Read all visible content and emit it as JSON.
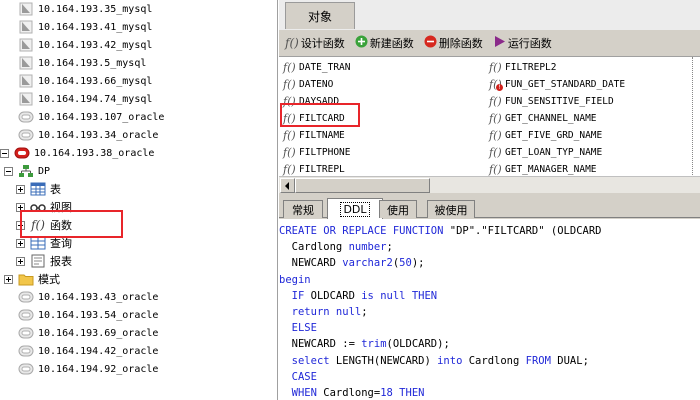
{
  "tree": {
    "items_before": [
      {
        "label": "10.164.193.35_mysql",
        "type": "mysql"
      },
      {
        "label": "10.164.193.41_mysql",
        "type": "mysql"
      },
      {
        "label": "10.164.193.42_mysql",
        "type": "mysql"
      },
      {
        "label": "10.164.193.5_mysql",
        "type": "mysql"
      },
      {
        "label": "10.164.193.66_mysql",
        "type": "mysql"
      },
      {
        "label": "10.164.194.74_mysql",
        "type": "mysql"
      },
      {
        "label": "10.164.193.107_oracle",
        "type": "oracle"
      },
      {
        "label": "10.164.193.34_oracle",
        "type": "oracle"
      }
    ],
    "expanded_server": "10.164.193.38_oracle",
    "schema": "DP",
    "schema_children": [
      "表",
      "视图",
      "函数",
      "查询",
      "报表"
    ],
    "models": "模式",
    "items_after": [
      "10.164.193.43_oracle",
      "10.164.193.54_oracle",
      "10.164.193.69_oracle",
      "10.164.194.42_oracle",
      "10.164.194.92_oracle"
    ]
  },
  "panel": {
    "tab": "对象",
    "toolbar": {
      "design": "设计函数",
      "new": "新建函数",
      "delete": "删除函数",
      "run": "运行函数"
    },
    "functions_col1": [
      "DATE_TRAN",
      "DATENO",
      "DAYSADD",
      "FILTCARD",
      "FILTNAME",
      "FILTPHONE",
      "FILTREPL"
    ],
    "functions_col2": [
      "FILTREPL2",
      "FUN_GET_STANDARD_DATE",
      "FUN_SENSITIVE_FIELD",
      "GET_CHANNEL_NAME",
      "GET_FIVE_GRD_NAME",
      "GET_LOAN_TYP_NAME",
      "GET_MANAGER_NAME"
    ],
    "subtabs": [
      "常规",
      "DDL",
      "使用",
      "被使用"
    ],
    "code": [
      "CREATE OR REPLACE FUNCTION \"DP\".\"FILTCARD\" (OLDCARD",
      "  Cardlong number;",
      "  NEWCARD varchar2(50);",
      "begin",
      "  IF OLDCARD is null THEN",
      "  return null;",
      "  ELSE",
      "  NEWCARD := trim(OLDCARD);",
      "  select LENGTH(NEWCARD) into Cardlong FROM DUAL;",
      "  CASE",
      "  WHEN Cardlong=18 THEN"
    ]
  },
  "colors": {
    "keyword": "#2028d8",
    "highlight": "#e8252a",
    "panel_bg": "#d4d0c8"
  }
}
